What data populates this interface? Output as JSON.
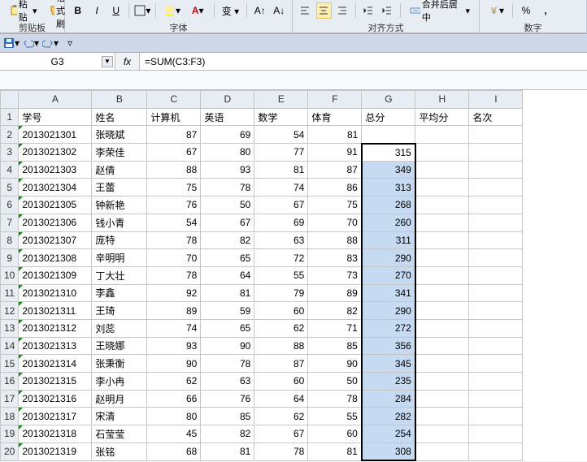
{
  "ribbon": {
    "clipboard": {
      "label": "剪贴板",
      "paste": "粘贴",
      "format_painter": "格式刷"
    },
    "font": {
      "label": "字体"
    },
    "align": {
      "label": "对齐方式",
      "merge": "合并后居中"
    },
    "number": {
      "label": "数字"
    }
  },
  "name_box": "G3",
  "fx_label": "fx",
  "formula": "=SUM(C3:F3)",
  "columns": [
    "A",
    "B",
    "C",
    "D",
    "E",
    "F",
    "G",
    "H",
    "I"
  ],
  "headers": [
    "学号",
    "姓名",
    "计算机",
    "英语",
    "数学",
    "体育",
    "总分",
    "平均分",
    "名次"
  ],
  "rows": [
    {
      "n": 2,
      "id": "2013021301",
      "name": "张晓斌",
      "c": 87,
      "d": 69,
      "e": 54,
      "f": 81,
      "g": ""
    },
    {
      "n": 3,
      "id": "2013021302",
      "name": "李荣佳",
      "c": 67,
      "d": 80,
      "e": 77,
      "f": 91,
      "g": 315
    },
    {
      "n": 4,
      "id": "2013021303",
      "name": "赵倩",
      "c": 88,
      "d": 93,
      "e": 81,
      "f": 87,
      "g": 349
    },
    {
      "n": 5,
      "id": "2013021304",
      "name": "王蕾",
      "c": 75,
      "d": 78,
      "e": 74,
      "f": 86,
      "g": 313
    },
    {
      "n": 6,
      "id": "2013021305",
      "name": "钟新艳",
      "c": 76,
      "d": 50,
      "e": 67,
      "f": 75,
      "g": 268
    },
    {
      "n": 7,
      "id": "2013021306",
      "name": "钱小青",
      "c": 54,
      "d": 67,
      "e": 69,
      "f": 70,
      "g": 260
    },
    {
      "n": 8,
      "id": "2013021307",
      "name": "庞特",
      "c": 78,
      "d": 82,
      "e": 63,
      "f": 88,
      "g": 311
    },
    {
      "n": 9,
      "id": "2013021308",
      "name": "辛明明",
      "c": 70,
      "d": 65,
      "e": 72,
      "f": 83,
      "g": 290
    },
    {
      "n": 10,
      "id": "2013021309",
      "name": "丁大壮",
      "c": 78,
      "d": 64,
      "e": 55,
      "f": 73,
      "g": 270
    },
    {
      "n": 11,
      "id": "2013021310",
      "name": "李鑫",
      "c": 92,
      "d": 81,
      "e": 79,
      "f": 89,
      "g": 341
    },
    {
      "n": 12,
      "id": "2013021311",
      "name": "王琦",
      "c": 89,
      "d": 59,
      "e": 60,
      "f": 82,
      "g": 290
    },
    {
      "n": 13,
      "id": "2013021312",
      "name": "刘蕊",
      "c": 74,
      "d": 65,
      "e": 62,
      "f": 71,
      "g": 272
    },
    {
      "n": 14,
      "id": "2013021313",
      "name": "王晓娜",
      "c": 93,
      "d": 90,
      "e": 88,
      "f": 85,
      "g": 356
    },
    {
      "n": 15,
      "id": "2013021314",
      "name": "张秉衡",
      "c": 90,
      "d": 78,
      "e": 87,
      "f": 90,
      "g": 345
    },
    {
      "n": 16,
      "id": "2013021315",
      "name": "李小冉",
      "c": 62,
      "d": 63,
      "e": 60,
      "f": 50,
      "g": 235
    },
    {
      "n": 17,
      "id": "2013021316",
      "name": "赵明月",
      "c": 66,
      "d": 76,
      "e": 64,
      "f": 78,
      "g": 284
    },
    {
      "n": 18,
      "id": "2013021317",
      "name": "宋清",
      "c": 80,
      "d": 85,
      "e": 62,
      "f": 55,
      "g": 282
    },
    {
      "n": 19,
      "id": "2013021318",
      "name": "石莹莹",
      "c": 45,
      "d": 82,
      "e": 67,
      "f": 60,
      "g": 254
    },
    {
      "n": 20,
      "id": "2013021319",
      "name": "张铭",
      "c": 68,
      "d": 81,
      "e": 78,
      "f": 81,
      "g": 308
    }
  ]
}
